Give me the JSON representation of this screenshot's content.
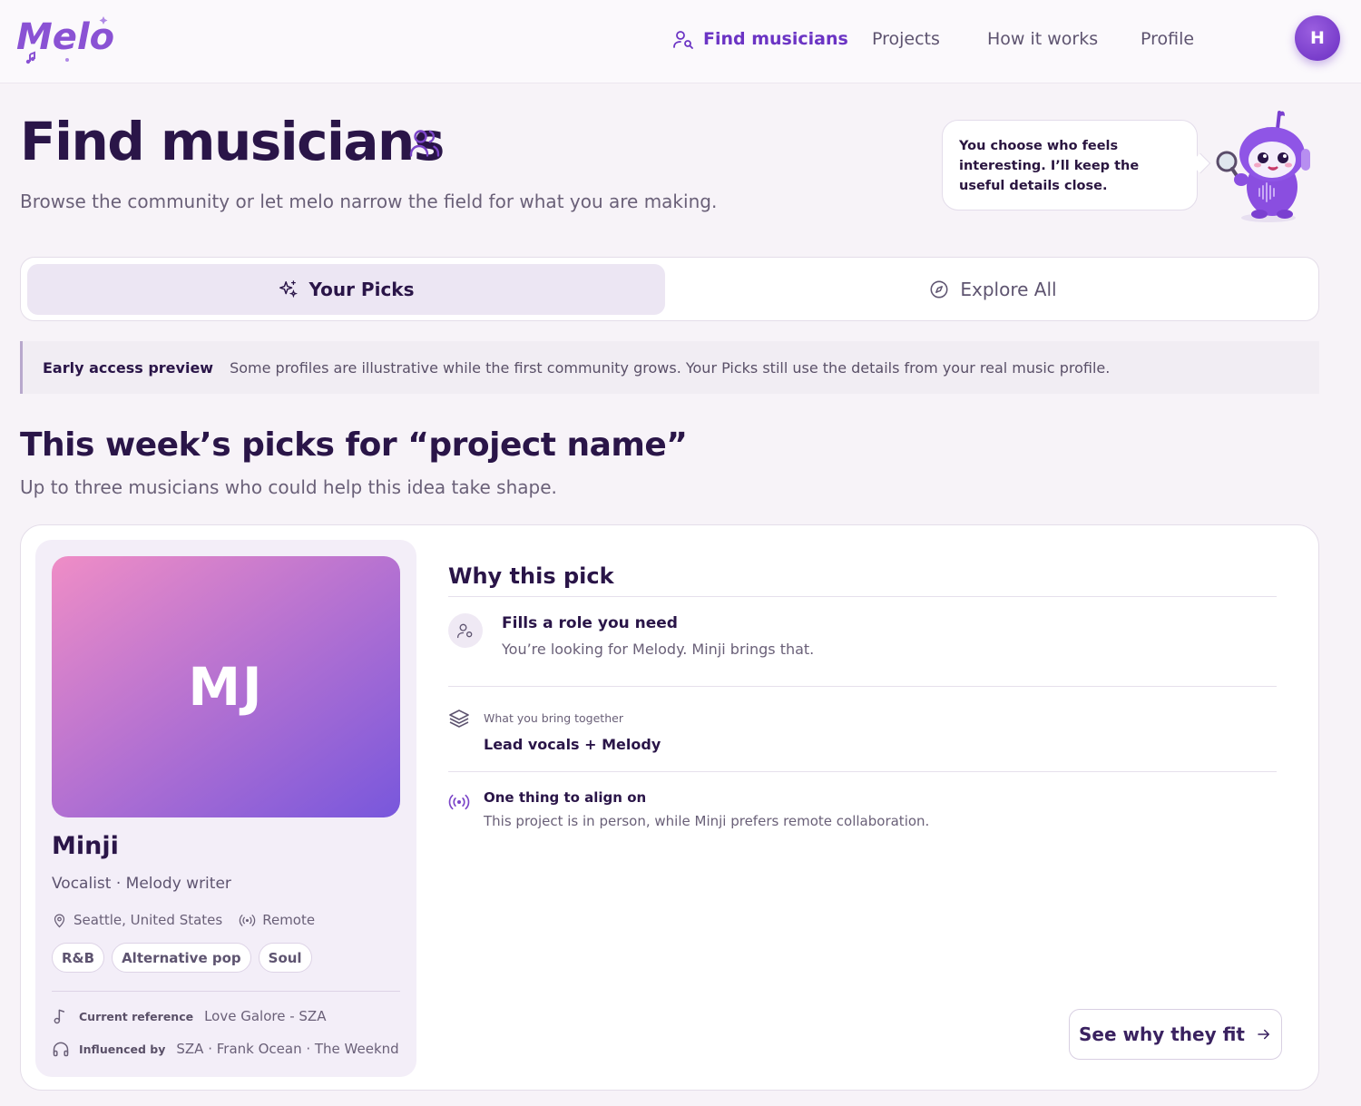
{
  "header": {
    "logo_text": "Melo",
    "nav": [
      {
        "label": "Find musicians",
        "active": true
      },
      {
        "label": "Projects"
      },
      {
        "label": "How it works"
      },
      {
        "label": "Profile"
      }
    ],
    "avatar_initial": "H"
  },
  "hero": {
    "title": "Find musicians",
    "subtitle": "Browse the community or let melo narrow the field for what you are making.",
    "mascot_bubble": "You choose who feels interesting. I’ll keep the useful details close."
  },
  "tabs": [
    {
      "label": "Your Picks",
      "icon": "sparkles-icon",
      "active": true
    },
    {
      "label": "Explore All",
      "icon": "compass-icon"
    }
  ],
  "notice": {
    "label": "Early access preview",
    "text": "Some profiles are illustrative while the first community grows. Your Picks still use the details from your real music profile."
  },
  "picks": {
    "title": "This week’s picks for “project name”",
    "subtitle": "Up to three musicians who could help this idea take shape."
  },
  "musician": {
    "initials": "MJ",
    "name": "Minji",
    "roles": "Vocalist · Melody writer",
    "location": "Seattle, United States",
    "mode": "Remote",
    "genres": [
      "R&B",
      "Alternative pop",
      "Soul"
    ],
    "current_reference_label": "Current reference",
    "current_reference": "Love Galore - SZA",
    "influenced_by_label": "Influenced by",
    "influenced_by": "SZA · Frank Ocean · The Weeknd"
  },
  "why": {
    "title": "Why this pick",
    "role_heading": "Fills a role you need",
    "role_text": "You’re looking for Melody. Minji brings that.",
    "together_label": "What you bring together",
    "together_value": "Lead vocals + Melody",
    "align_heading": "One thing to align on",
    "align_text": "This project is in person, while Minji prefers remote collaboration.",
    "cta_label": "See why they fit"
  },
  "colors": {
    "accent": "#6b34c4",
    "background": "#f7f3f8",
    "heading": "#2a1548"
  }
}
